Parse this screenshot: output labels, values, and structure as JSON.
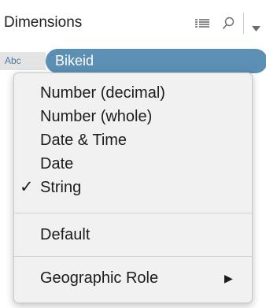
{
  "header": {
    "title": "Dimensions",
    "icons": [
      "list-view-icon",
      "search-icon",
      "chevron-down-icon"
    ]
  },
  "field": {
    "type_badge": "Abc",
    "name": "Bikeid"
  },
  "menu": {
    "items": [
      {
        "label": "Number (decimal)",
        "checked": false
      },
      {
        "label": "Number (whole)",
        "checked": false
      },
      {
        "label": "Date & Time",
        "checked": false
      },
      {
        "label": "Date",
        "checked": false
      },
      {
        "label": "String",
        "checked": true,
        "check_glyph": "✓"
      }
    ],
    "default_label": "Default",
    "geo_label": "Geographic Role",
    "submenu_arrow": "▶"
  },
  "colors": {
    "pill": "#5b8fb4",
    "badge_bg": "#e4e4e4",
    "menu_bg": "#f1f1f1"
  }
}
